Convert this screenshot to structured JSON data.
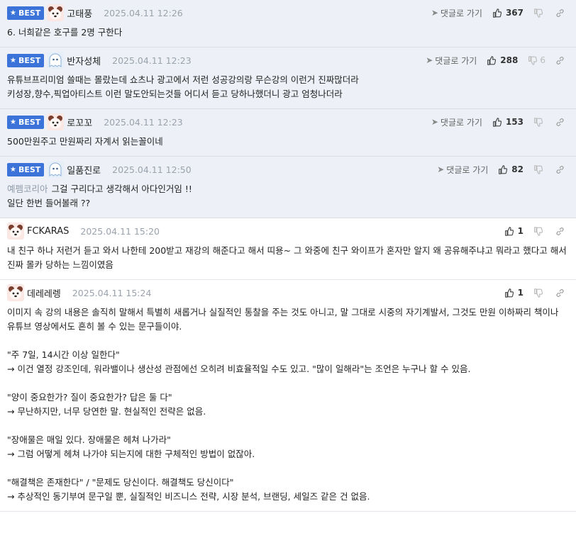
{
  "colors": {
    "best_bg": "#edf1f7",
    "badge": "#3b73d9",
    "date": "#9aa2ad"
  },
  "best_label": "BEST",
  "reply_label": "댓글로 가기",
  "comments": [
    {
      "type": "best",
      "avatar": "dog-avatar-icon",
      "nick": "고태풍",
      "date": "2025.04.11 12:26",
      "likes": "367",
      "dislikes": "",
      "prefix": "",
      "text": "6. 너희같은 호구를 2명 구한다"
    },
    {
      "type": "best",
      "avatar": "ghost-avatar-icon",
      "nick": "반자성체",
      "date": "2025.04.11 12:23",
      "likes": "288",
      "dislikes": "6",
      "prefix": "",
      "text": "유튜브프리미엄 쓸때는 몰랐는데 쇼츠나 광고에서 저런 성공강의랑 무슨강의 이런거 진짜많더라\n키성장,향수,픽업아티스트 이런 말도안되는것들 어디서 듣고 당하나했더니 광고 엄청나더라"
    },
    {
      "type": "best",
      "avatar": "dog-avatar-icon",
      "nick": "로꼬꼬",
      "date": "2025.04.11 12:23",
      "likes": "153",
      "dislikes": "",
      "prefix": "",
      "text": "500만원주고 만원짜리 자계서 읽는꼴이네"
    },
    {
      "type": "best",
      "avatar": "ghost-avatar-icon",
      "nick": "일품진로",
      "date": "2025.04.11 12:50",
      "likes": "82",
      "dislikes": "",
      "prefix": "예펨코리아",
      "text": "그걸 구리다고 생각해서 아다인거임 !!\n일단 한번 들어볼래 ??"
    },
    {
      "type": "normal",
      "avatar": "dog-avatar-icon",
      "nick": "FCKARAS",
      "date": "2025.04.11 15:20",
      "likes": "1",
      "dislikes": "",
      "prefix": "",
      "text": "내 친구 하나 저런거 듣고 와서 나한테 200받고 재강의 해준다고 해서 띠용~ 그 와중에 친구 와이프가 혼자만 알지 왜 공유해주냐고 뭐라고 했다고 해서 진짜 몰카 당하는 느낌이였음"
    },
    {
      "type": "normal",
      "avatar": "dog-avatar-icon",
      "nick": "데레레렝",
      "date": "2025.04.11 15:24",
      "likes": "1",
      "dislikes": "",
      "prefix": "",
      "text": "이미지 속 강의 내용은 솔직히 말해서 특별히 새롭거나 실질적인 통찰을 주는 것도 아니고, 말 그대로 시중의 자기계발서, 그것도 만원 이하짜리 책이나 유튜브 영상에서도 흔히 볼 수 있는 문구들이야.\n\n\"주 7일, 14시간 이상 일한다\"\n→ 이건 열정 강조인데, 워라밸이나 생산성 관점에선 오히려 비효율적일 수도 있고. \"많이 일해라\"는 조언은 누구나 할 수 있음.\n\n\"양이 중요한가? 질이 중요한가? 답은 둘 다\"\n→ 무난하지만, 너무 당연한 말. 현실적인 전략은 없음.\n\n\"장애물은 매일 있다. 장애물은 헤쳐 나가라\"\n→ 그럼 어떻게 헤쳐 나가야 되는지에 대한 구체적인 방법이 없잖아.\n\n\"해결책은 존재한다\" / \"문제도 당신이다. 해결책도 당신이다\"\n→ 추상적인 동기부여 문구일 뿐, 실질적인 비즈니스 전략, 시장 분석, 브랜딩, 세일즈 같은 건 없음."
    }
  ]
}
